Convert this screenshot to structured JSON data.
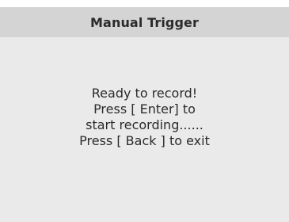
{
  "header": {
    "title": "Manual Trigger"
  },
  "message": {
    "lines": [
      "Ready to record!",
      "Press [ Enter] to",
      "start recording......",
      "Press [ Back ] to exit"
    ]
  },
  "colors": {
    "header_bg": "#d4d4d4",
    "panel_bg": "#eaeaea",
    "text": "#2b2b2b"
  }
}
